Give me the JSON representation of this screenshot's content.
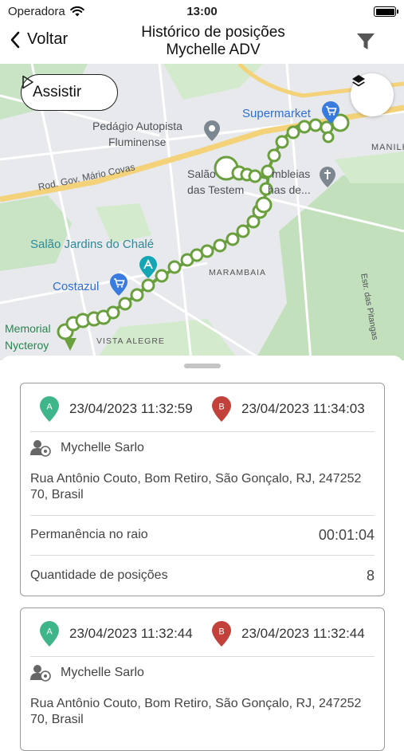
{
  "status_bar": {
    "carrier": "Operadora",
    "time": "13:00"
  },
  "nav": {
    "back_label": "Voltar",
    "title_line1": "Histórico de posições",
    "title_line2": "Mychelle ADV"
  },
  "map": {
    "play_label": "Assistir",
    "labels": {
      "toll": "Pedágio Autopista",
      "toll2": "Fluminense",
      "supermarket": "Supermarket",
      "road": "Rod. Gov. Mário Covas",
      "church1": "Salão do Reino das Testemunhas de...",
      "church_a": "Salão",
      "church_b": "mbleias",
      "church_c": "das Testem",
      "church_d": "has de...",
      "manilha": "MANILHA",
      "salao": "Salão Jardins do Chalé",
      "costazul": "Costazul",
      "marambaia": "MARAMBAIA",
      "memorial1": "Memorial",
      "memorial2": "Nycteroy",
      "vista": "VISTA ALEGRE",
      "estrada": "Estr. das Pitangas"
    },
    "route_color": "#6a9f3e"
  },
  "cards": [
    {
      "start_marker": "A",
      "start_time": "23/04/2023 11:32:59",
      "end_marker": "B",
      "end_time": "23/04/2023 11:34:03",
      "user": "Mychelle Sarlo",
      "address_line1": "Rua Antônio Couto, Bom Retiro, São Gonçalo, RJ, 247252",
      "address_line2": "70, Brasil",
      "stay_label": "Permanência no raio",
      "stay_value": "00:01:04",
      "count_label": "Quantidade de posições",
      "count_value": "8"
    },
    {
      "start_marker": "A",
      "start_time": "23/04/2023 11:32:44",
      "end_marker": "B",
      "end_time": "23/04/2023 11:32:44",
      "user": "Mychelle Sarlo",
      "address_line1": "Rua Antônio Couto, Bom Retiro, São Gonçalo, RJ, 247252",
      "address_line2": "70, Brasil"
    }
  ]
}
